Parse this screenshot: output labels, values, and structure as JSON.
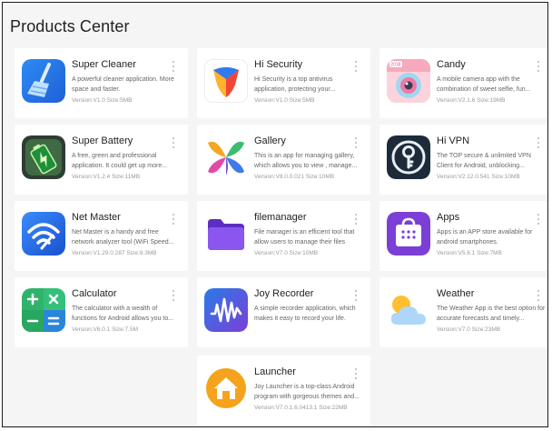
{
  "page": {
    "title": "Products Center"
  },
  "apps": [
    {
      "name": "Super Cleaner",
      "description": "A powerful cleaner application. More space and faster.",
      "version": "Version:V1.0 Size:5MB",
      "icon": "broom-icon"
    },
    {
      "name": "Hi Security",
      "description": "Hi Security is a top antivirus application, protecting your...",
      "version": "Version:V1.0 Size:5MB",
      "icon": "shield-icon"
    },
    {
      "name": "Candy",
      "description": "A mobile camera app with the combination of sweet selfie, fun...",
      "version": "Version:V2.1.6 Size:19MB",
      "icon": "camera-icon",
      "badge": "2018"
    },
    {
      "name": "Super Battery",
      "description": "A free, green and professional application. It could get up more...",
      "version": "Version:V1.2.4 Size:11MB",
      "icon": "battery-icon"
    },
    {
      "name": "Gallery",
      "description": "This is an app for managing gallery, which allows you to view , manage...",
      "version": "Version:V8.0.0.021 Size:10MB",
      "icon": "pinwheel-icon"
    },
    {
      "name": "Hi VPN",
      "description": "The TOP secure & unlimited VPN Client for Android, unblocking...",
      "version": "Version:V2.12.0.541 Size:10MB",
      "icon": "key-icon"
    },
    {
      "name": "Net Master",
      "description": "Net Master is a handy and free network analyzer tool (WiFi Speed...",
      "version": "Version:V1.29.0.287 Size:9.3MB",
      "icon": "wifi-icon"
    },
    {
      "name": "filemanager",
      "description": "File manager is an efficient tool that allow users to manage their files",
      "version": "Version:V7.0 Size:10MB",
      "icon": "folder-icon"
    },
    {
      "name": "Apps",
      "description": "Apps is an APP store available for android smartphones.",
      "version": "Version:V5.6.1 Size:7MB",
      "icon": "store-icon"
    },
    {
      "name": "Calculator",
      "description": "The calculator with a wealth of functions for Android allows you to...",
      "version": "Version:V6.0.1 Size:7.5M",
      "icon": "calculator-icon"
    },
    {
      "name": "Joy Recorder",
      "description": "A simple recorder application, which makes it easy to record your life.",
      "version": "",
      "icon": "waveform-icon"
    },
    {
      "name": "Weather",
      "description": "The Weather App is the best option for accurate forecasts and timely...",
      "version": "Version:V7.0 Size:23MB",
      "icon": "weather-icon"
    },
    {
      "name": "Launcher",
      "description": "Joy Launcher is a top-class Android program with gorgeous themes and...",
      "version": "Version:V7.0.1.6.0413.1 Size:22MB",
      "icon": "home-icon"
    }
  ]
}
